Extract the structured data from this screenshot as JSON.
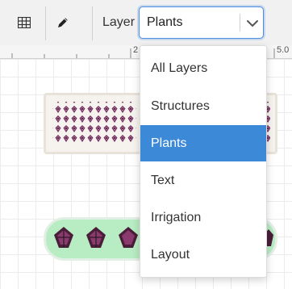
{
  "toolbar": {
    "grid_icon": "grid-icon",
    "pencil_icon": "pencil-icon",
    "layer_label": "Layer",
    "layer_value": "Plants",
    "chevron_icon": "chevron-down-icon"
  },
  "ruler": {
    "labels": [
      "2",
      "5.0"
    ]
  },
  "layer_menu": {
    "options": [
      {
        "label": "All Layers",
        "selected": false
      },
      {
        "label": "Structures",
        "selected": false
      },
      {
        "label": "Plants",
        "selected": true
      },
      {
        "label": "Text",
        "selected": false
      },
      {
        "label": "Irrigation",
        "selected": false
      },
      {
        "label": "Layout",
        "selected": false
      }
    ]
  },
  "colors": {
    "accent": "#3c89d8",
    "plant_purple": "#6d2a5c",
    "plant_dark": "#2b1b26",
    "plant_pink": "#c77aa8",
    "bed_green": "#b8ecc3"
  }
}
